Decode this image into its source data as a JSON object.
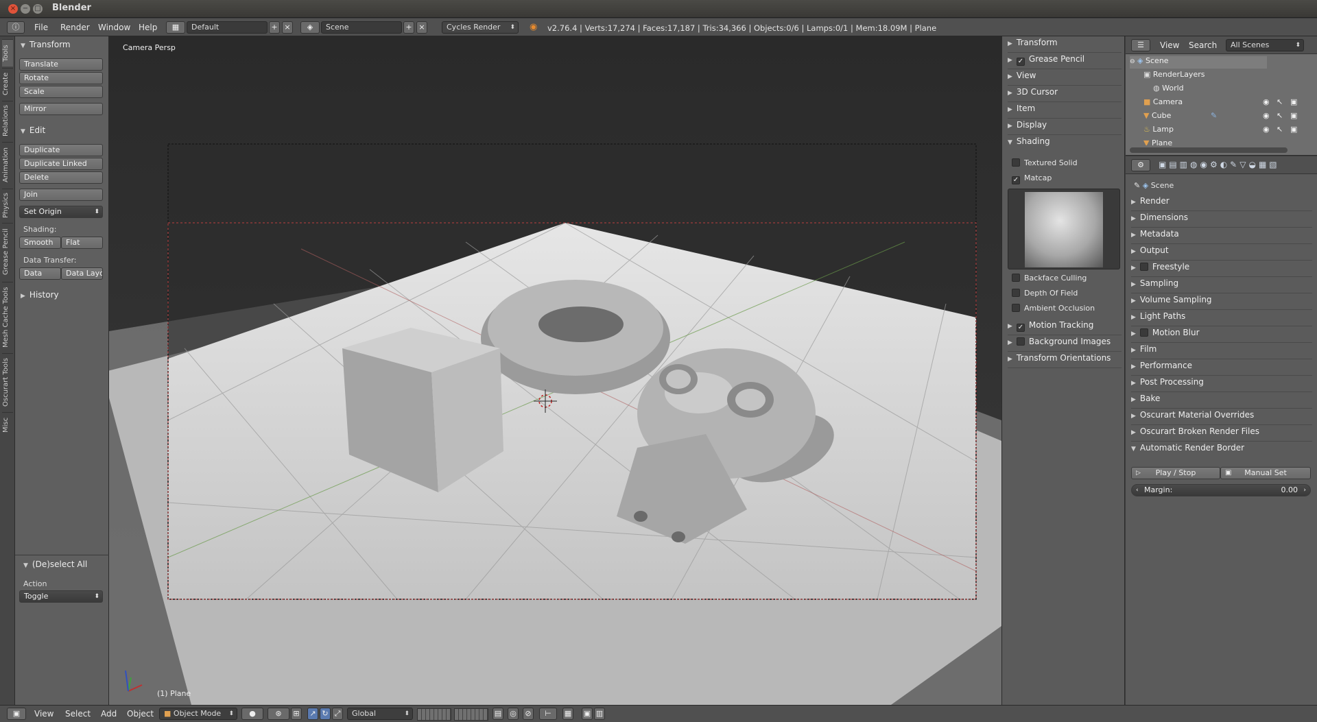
{
  "window": {
    "title": "Blender"
  },
  "infobar": {
    "menus": [
      "File",
      "Render",
      "Window",
      "Help"
    ],
    "layout": "Default",
    "scene": "Scene",
    "engine": "Cycles Render",
    "stats": "v2.76.4 | Verts:17,274 | Faces:17,187 | Tris:34,366 | Objects:0/6 | Lamps:0/1 | Mem:18.09M | Plane"
  },
  "lefttabs": [
    "Tools",
    "Create",
    "Relations",
    "Animation",
    "Physics",
    "Grease Pencil",
    "Mesh Cache Tools",
    "Oscurart Tools",
    "Misc"
  ],
  "toolshelf": {
    "transform_header": "Transform",
    "translate": "Translate",
    "rotate": "Rotate",
    "scale": "Scale",
    "mirror": "Mirror",
    "edit_header": "Edit",
    "duplicate": "Duplicate",
    "duplicate_linked": "Duplicate Linked",
    "delete": "Delete",
    "join": "Join",
    "set_origin": "Set Origin",
    "shading_label": "Shading:",
    "smooth": "Smooth",
    "flat": "Flat",
    "data_transfer_label": "Data Transfer:",
    "data": "Data",
    "data_layout": "Data Layo",
    "history_header": "History",
    "deselect_header": "(De)select All",
    "action_label": "Action",
    "action_value": "Toggle"
  },
  "viewport": {
    "view_label": "Camera Persp",
    "object_label": "(1) Plane"
  },
  "rpanel": {
    "transform": "Transform",
    "grease_pencil": "Grease Pencil",
    "view": "View",
    "cursor": "3D Cursor",
    "item": "Item",
    "display": "Display",
    "shading": "Shading",
    "textured_solid": "Textured Solid",
    "matcap": "Matcap",
    "backface": "Backface Culling",
    "dof": "Depth Of Field",
    "ao": "Ambient Occlusion",
    "motion_tracking": "Motion Tracking",
    "background_images": "Background Images",
    "transform_orient": "Transform Orientations"
  },
  "outliner": {
    "view": "View",
    "search": "Search",
    "scenes": "All Scenes",
    "items": [
      "Scene",
      "RenderLayers",
      "World",
      "Camera",
      "Cube",
      "Lamp",
      "Plane"
    ]
  },
  "props": {
    "scene": "Scene",
    "panels": [
      "Render",
      "Dimensions",
      "Metadata",
      "Output",
      "Freestyle",
      "Sampling",
      "Volume Sampling",
      "Light Paths",
      "Motion Blur",
      "Film",
      "Performance",
      "Post Processing",
      "Bake",
      "Oscurart Material Overrides",
      "Oscurart Broken Render Files",
      "Automatic Render Border"
    ],
    "play_stop": "Play / Stop",
    "manual_set": "Manual Set",
    "margin_label": "Margin:",
    "margin_value": "0.00"
  },
  "bottombar": {
    "view": "View",
    "select": "Select",
    "add": "Add",
    "object": "Object",
    "mode": "Object Mode",
    "orientation": "Global"
  }
}
